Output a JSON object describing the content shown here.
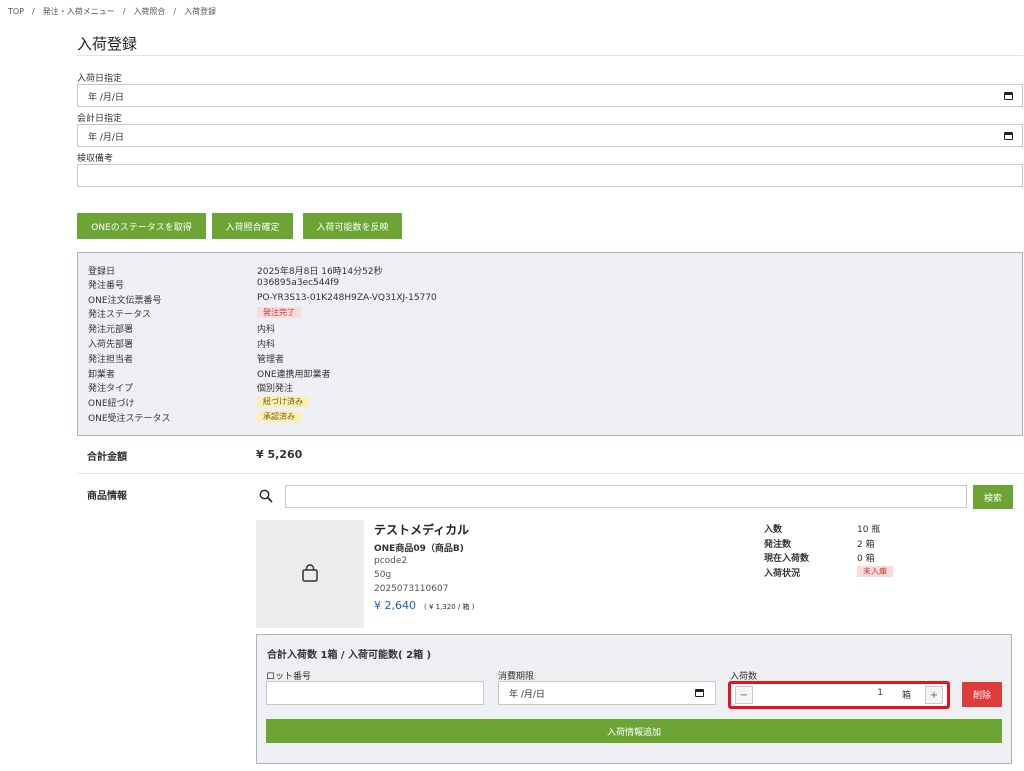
{
  "breadcrumb": {
    "items": [
      "TOP",
      "発注・入荷メニュー",
      "入荷照合",
      "入荷登録"
    ],
    "separator": "/"
  },
  "page": {
    "title": "入荷登録"
  },
  "form": {
    "arrival_date_label": "入荷日指定",
    "arrival_date_placeholder": "年 /月/日",
    "accounting_date_label": "会計日指定",
    "accounting_date_placeholder": "年 /月/日",
    "inspection_note_label": "検収備考",
    "inspection_note_value": ""
  },
  "actions": {
    "get_one_status": "ONEのステータスを取得",
    "confirm_arrival": "入荷照合確定",
    "reflect_available": "入荷可能数を反映"
  },
  "order_info": {
    "rows": [
      {
        "key": "登録日",
        "value": "2025年8月8日 16時14分52秒"
      },
      {
        "key": "発注番号",
        "value": "036895a3ec544f9"
      },
      {
        "key": "ONE注文伝票番号",
        "value": "PO-YR3S13-01K248H9ZA-VQ31XJ-15770"
      },
      {
        "key": "発注ステータス",
        "badge": "発注完了"
      },
      {
        "key": "発注元部署",
        "value": "内科"
      },
      {
        "key": "入荷先部署",
        "value": "内科"
      },
      {
        "key": "発注担当者",
        "value": "管理者"
      },
      {
        "key": "卸業者",
        "value": "ONE連携用卸業者"
      },
      {
        "key": "発注タイプ",
        "value": "個別発注"
      },
      {
        "key": "ONE紐づけ",
        "badge": "紐づけ済み"
      },
      {
        "key": "ONE受注ステータス",
        "badge": "承認済み"
      }
    ]
  },
  "total": {
    "label": "合計金額",
    "value": "¥ 5,260"
  },
  "product_section": {
    "label": "商品情報",
    "search_placeholder": "",
    "search_button": "検索"
  },
  "product": {
    "maker": "テストメディカル",
    "name": "ONE商品09（商品B)",
    "code": "pcode2",
    "spec": "50g",
    "jan": "2025073110607",
    "price": "¥ 2,640",
    "unit_price": "( ¥ 1,320 / 箱 )",
    "stats": [
      {
        "key": "入数",
        "value": "10 瓶"
      },
      {
        "key": "発注数",
        "value": "2 箱"
      },
      {
        "key": "現在入荷数",
        "value": "0 箱"
      },
      {
        "key": "入荷状況",
        "badge": "未入庫"
      }
    ]
  },
  "lot": {
    "summary": "合計入荷数 1箱 / 入荷可能数( 2箱 )",
    "lot_label": "ロット番号",
    "lot_value": "",
    "expiry_label": "消費期限",
    "expiry_placeholder": "年 /月/日",
    "qty_label": "入荷数",
    "qty_minus": "−",
    "qty_value": "1",
    "qty_unit": "箱",
    "qty_plus": "+",
    "delete_button": "削除",
    "add_button": "入荷情報追加"
  },
  "colors": {
    "primary_green": "#6ca534",
    "danger_red": "#e03b3b",
    "highlight_red": "#e8131c",
    "price_blue": "#1f5fc8"
  }
}
